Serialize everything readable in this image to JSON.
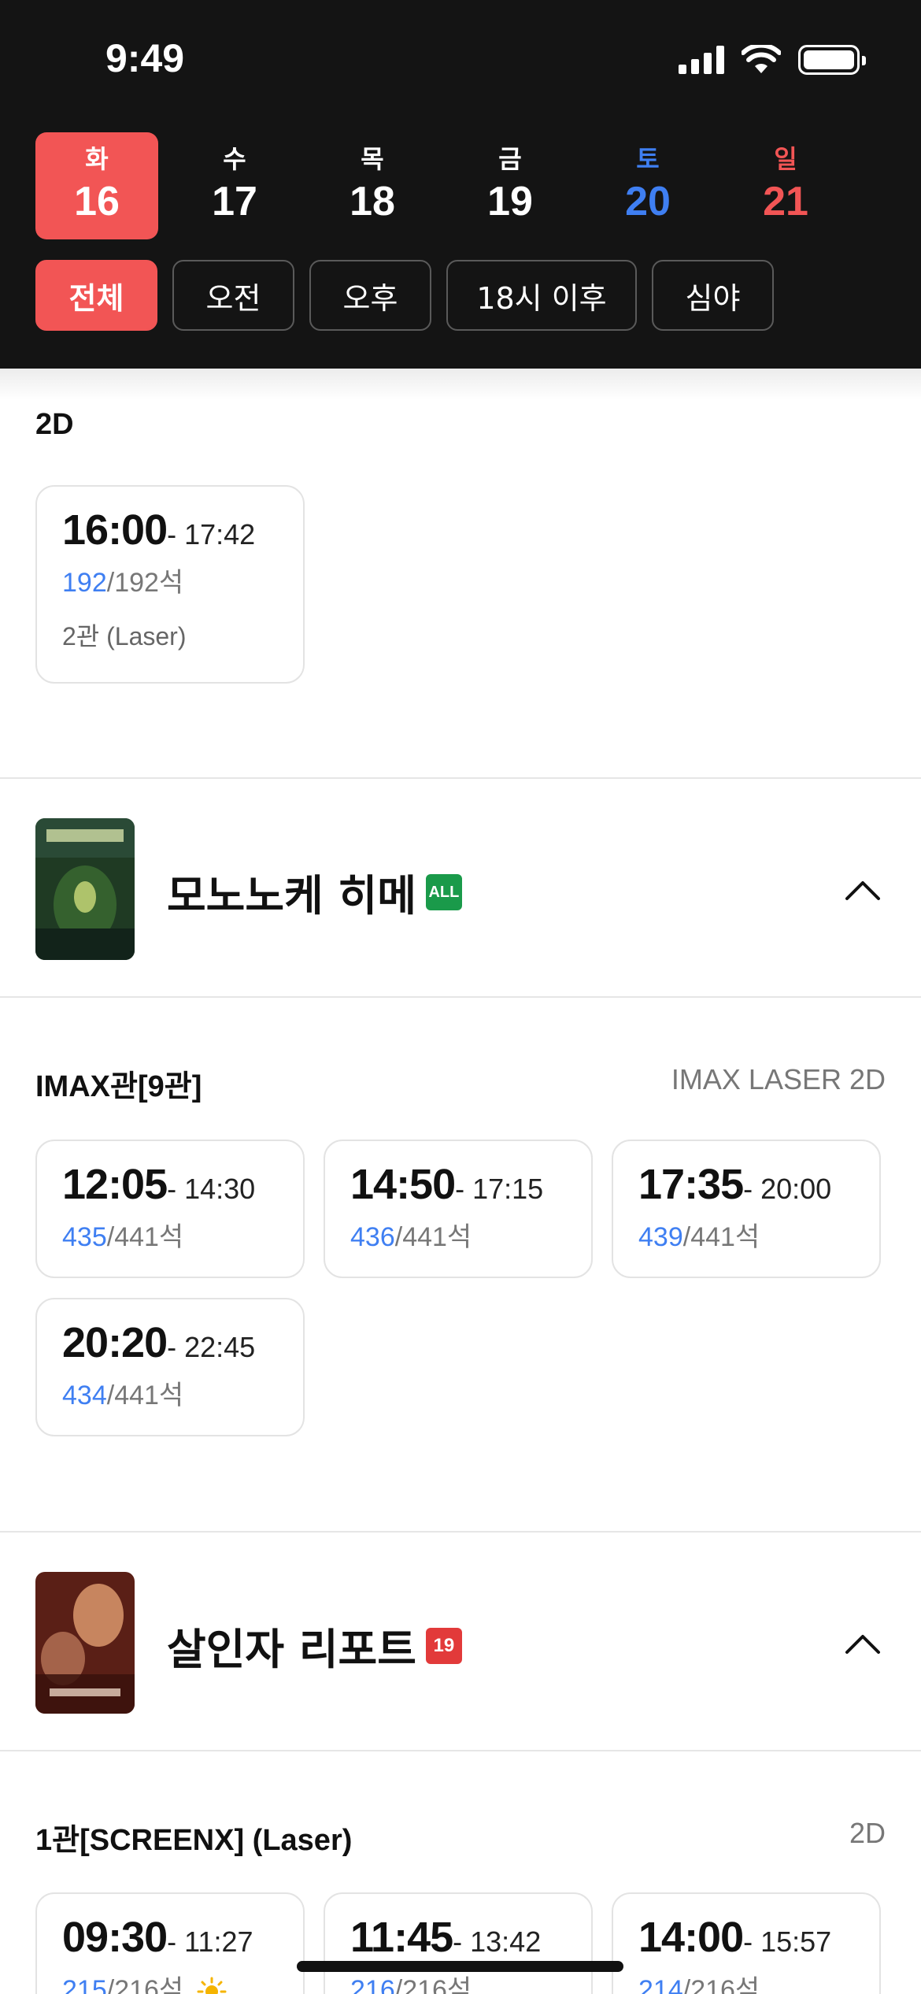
{
  "status_bar": {
    "time": "9:49"
  },
  "dates": [
    {
      "dow": "화",
      "num": "16",
      "selected": true,
      "kind": "weekday"
    },
    {
      "dow": "수",
      "num": "17",
      "selected": false,
      "kind": "weekday"
    },
    {
      "dow": "목",
      "num": "18",
      "selected": false,
      "kind": "weekday"
    },
    {
      "dow": "금",
      "num": "19",
      "selected": false,
      "kind": "weekday"
    },
    {
      "dow": "토",
      "num": "20",
      "selected": false,
      "kind": "sat"
    },
    {
      "dow": "일",
      "num": "21",
      "selected": false,
      "kind": "sun"
    }
  ],
  "filters": [
    "전체",
    "오전",
    "오후",
    "18시 이후",
    "심야"
  ],
  "first_section": {
    "title": "2D",
    "showtimes": [
      {
        "start": "16:00",
        "end": "- 17:42",
        "avail": "192",
        "total": "192석",
        "room": "2관 (Laser)"
      }
    ]
  },
  "movies": [
    {
      "title": "모노노케 히메",
      "rating": "ALL",
      "section": {
        "title": "IMAX관[9관]",
        "meta": "IMAX LASER 2D"
      },
      "showtimes": [
        {
          "start": "12:05",
          "end": "- 14:30",
          "avail": "435",
          "total": "441석"
        },
        {
          "start": "14:50",
          "end": "- 17:15",
          "avail": "436",
          "total": "441석"
        },
        {
          "start": "17:35",
          "end": "- 20:00",
          "avail": "439",
          "total": "441석"
        },
        {
          "start": "20:20",
          "end": "- 22:45",
          "avail": "434",
          "total": "441석"
        }
      ]
    },
    {
      "title": "살인자 리포트",
      "rating": "19",
      "section": {
        "title": "1관[SCREENX] (Laser)",
        "meta": "2D"
      },
      "showtimes": [
        {
          "start": "09:30",
          "end": "- 11:27",
          "avail": "215",
          "total": "216석"
        },
        {
          "start": "11:45",
          "end": "- 13:42",
          "avail": "216",
          "total": "216석"
        },
        {
          "start": "14:00",
          "end": "- 15:57",
          "avail": "214",
          "total": "216석"
        }
      ]
    }
  ],
  "colors": {
    "accent": "#f25555",
    "blue": "#3f7ff2",
    "header_bg": "#141414"
  },
  "icons": [
    "cellular-signal-icon",
    "wifi-icon",
    "battery-icon",
    "chevron-up-icon",
    "sun-icon"
  ]
}
